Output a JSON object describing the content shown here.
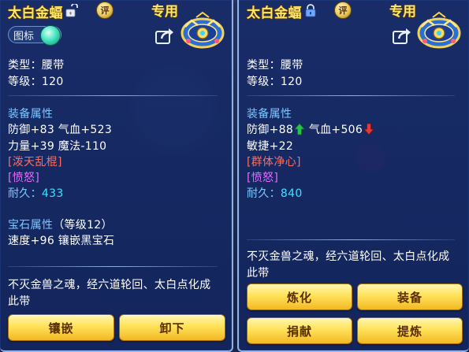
{
  "left": {
    "item_name": "太白金蝠",
    "lock_state": "unlocked",
    "appraise_badge": "评",
    "exclusive_label": "专用",
    "icon_toggle_label": "图标",
    "type_line": "类型：腰带",
    "level_line": "等级：120",
    "attr_title": "装备属性",
    "attr_line1": "防御+83 气血+523",
    "attr_line2": "力量+39 魔法-110",
    "special_skill": "[泼天乱棍]",
    "special_effect": "[愤怒]",
    "durability_label": "耐久：",
    "durability_value": "433",
    "gem_title": "宝石属性",
    "gem_level": "（等级12）",
    "gem_line": "速度+96 镶嵌黑宝石",
    "description": "不灭金兽之魂，经六道轮回、太白点化成此带",
    "buttons": [
      "镶嵌",
      "卸下"
    ]
  },
  "right": {
    "item_name": "太白金蝠",
    "lock_state": "locked",
    "appraise_badge": "评",
    "exclusive_label": "专用",
    "type_line": "类型：腰带",
    "level_line": "等级：120",
    "attr_title": "装备属性",
    "attr_def": "防御+88",
    "attr_hp": "气血+506",
    "attr_line2": "敏捷+22",
    "special_skill": "[群体净心]",
    "special_effect": "[愤怒]",
    "durability_label": "耐久：",
    "durability_value": "840",
    "description": "不灭金兽之魂，经六道轮回、太白点化成此带",
    "buttons": [
      "炼化",
      "装备",
      "捐献",
      "提炼"
    ]
  },
  "colors": {
    "name_gold": "#ffe76a",
    "section_blue": "#7fc6ff",
    "value_cyan": "#3fe0ff",
    "skill_red": "#ff6d5e",
    "effect_pink": "#e56cff",
    "up_green": "#29c24a",
    "down_red": "#e5393a"
  },
  "icons": {
    "lock_open": "unlocked-padlock-icon",
    "lock_closed": "locked-padlock-icon",
    "share": "share-icon",
    "item": "belt-item-icon",
    "up": "arrow-up-icon",
    "down": "arrow-down-icon"
  }
}
